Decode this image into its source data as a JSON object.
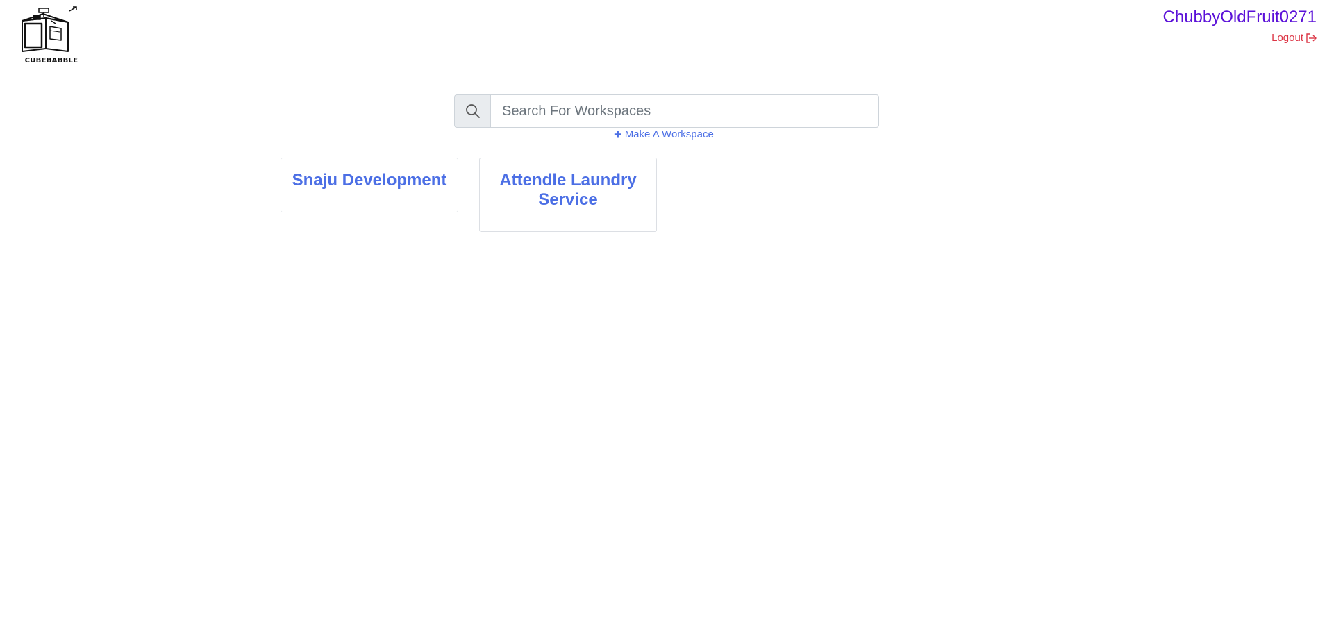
{
  "brand": {
    "name": "CUBEBABBLE"
  },
  "user": {
    "username": "ChubbyOldFruit0271",
    "logout_label": "Logout"
  },
  "search": {
    "placeholder": "Search For Workspaces",
    "value": ""
  },
  "actions": {
    "make_workspace_label": "Make A Workspace"
  },
  "workspaces": [
    {
      "name": "Snaju Development"
    },
    {
      "name": "Attendle Laundry Service"
    }
  ],
  "colors": {
    "username": "#5a10d8",
    "logout": "#dc3545",
    "link": "#4c6fe5"
  },
  "icons": {
    "search": "search-icon",
    "logout": "logout-icon",
    "plus": "plus-icon"
  }
}
